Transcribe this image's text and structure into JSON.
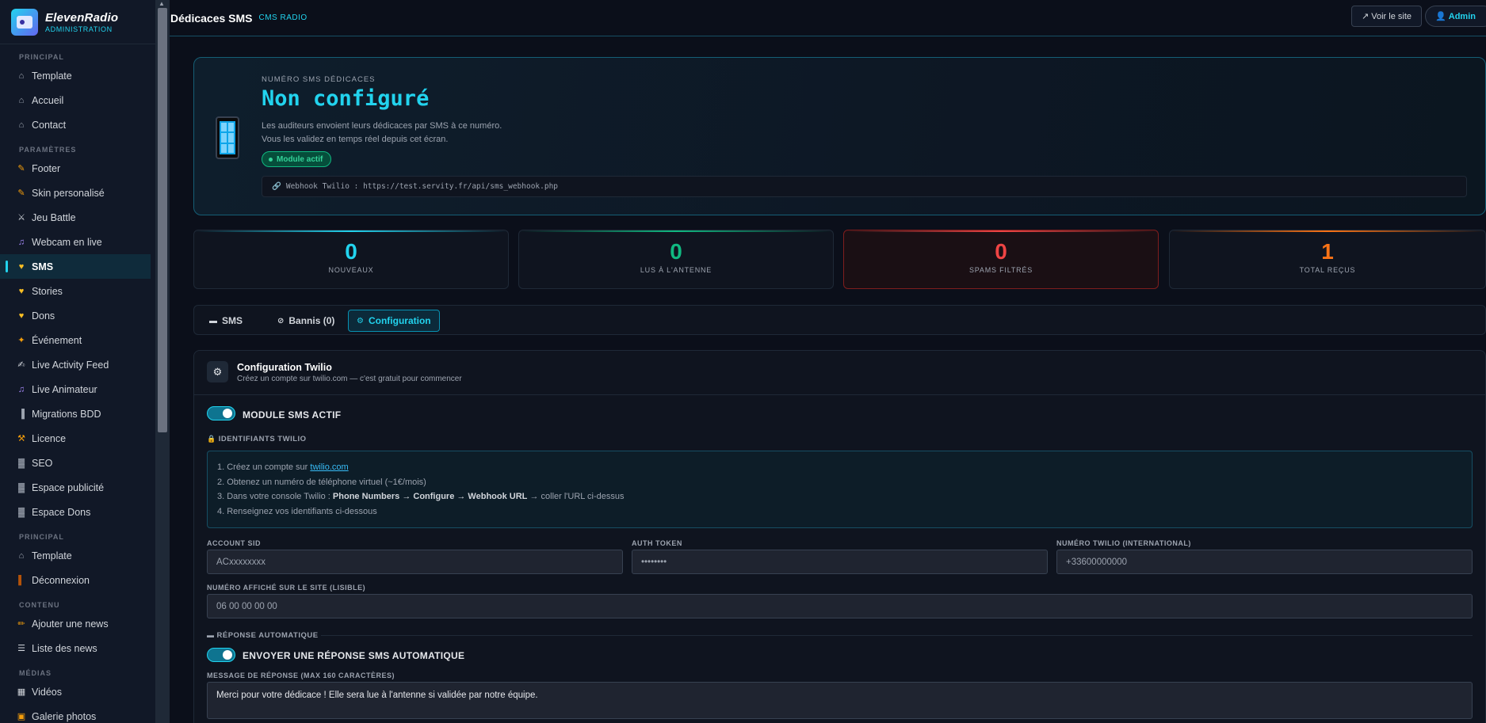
{
  "brand": {
    "name": "ElevenRadio",
    "subtitle": "ADMINISTRATION"
  },
  "sidebar": {
    "sections": [
      {
        "title": "PRINCIPAL",
        "items": [
          {
            "label": "Template",
            "icon": "home-icon",
            "glyph": "⌂"
          },
          {
            "label": "Accueil",
            "icon": "home-icon",
            "glyph": "⌂"
          },
          {
            "label": "Contact",
            "icon": "home-icon",
            "glyph": "⌂"
          }
        ]
      },
      {
        "title": "PARAMÈTRES",
        "items": [
          {
            "label": "Footer",
            "icon": "brush-icon",
            "glyph": "✎"
          },
          {
            "label": "Skin personalisé",
            "icon": "brush-icon",
            "glyph": "✎"
          },
          {
            "label": "Jeu Battle",
            "icon": "swords-icon",
            "glyph": "⚔"
          },
          {
            "label": "Webcam en live",
            "icon": "music-icon",
            "glyph": "♫"
          },
          {
            "label": "SMS",
            "icon": "heart-icon",
            "glyph": "♥",
            "active": true
          },
          {
            "label": "Stories",
            "icon": "heart-icon",
            "glyph": "♥"
          },
          {
            "label": "Dons",
            "icon": "heart-icon",
            "glyph": "♥"
          },
          {
            "label": "Événement",
            "icon": "party-icon",
            "glyph": "✦"
          },
          {
            "label": "Live Activity Feed",
            "icon": "feather-icon",
            "glyph": "✍"
          },
          {
            "label": "Live Animateur",
            "icon": "music-icon",
            "glyph": "♫"
          },
          {
            "label": "Migrations BDD",
            "icon": "database-icon",
            "glyph": "▐"
          },
          {
            "label": "Licence",
            "icon": "wrench-icon",
            "glyph": "⚒"
          },
          {
            "label": "SEO",
            "icon": "chart-icon",
            "glyph": "▓"
          },
          {
            "label": "Espace publicité",
            "icon": "chart-icon",
            "glyph": "▓"
          },
          {
            "label": "Espace Dons",
            "icon": "chart-icon",
            "glyph": "▓"
          }
        ]
      },
      {
        "title": "PRINCIPAL",
        "items": [
          {
            "label": "Template",
            "icon": "home-icon",
            "glyph": "⌂"
          },
          {
            "label": "Déconnexion",
            "icon": "door-icon",
            "glyph": "▌"
          }
        ]
      },
      {
        "title": "CONTENU",
        "items": [
          {
            "label": "Ajouter une news",
            "icon": "pencil-icon",
            "glyph": "✏"
          },
          {
            "label": "Liste des news",
            "icon": "list-icon",
            "glyph": "☰"
          }
        ]
      },
      {
        "title": "MÉDIAS",
        "items": [
          {
            "label": "Vidéos",
            "icon": "film-icon",
            "glyph": "▦"
          },
          {
            "label": "Galerie photos",
            "icon": "image-icon",
            "glyph": "▣"
          }
        ]
      }
    ]
  },
  "topbar": {
    "title": "Dédicaces SMS",
    "tag": "CMS RADIO",
    "view_site": "↗ Voir le site",
    "user": "👤 Admin"
  },
  "hero": {
    "label": "NUMÉRO SMS DÉDICACES",
    "number": "Non configuré",
    "desc_line1": "Les auditeurs envoient leurs dédicaces par SMS à ce numéro.",
    "desc_line2": "Vous les validez en temps réel depuis cet écran.",
    "status": "Module actif",
    "webhook": "Webhook Twilio : https://test.servity.fr/api/sms_webhook.php"
  },
  "stats": [
    {
      "value": "0",
      "label": "NOUVEAUX",
      "color": "#22d3ee"
    },
    {
      "value": "0",
      "label": "LUS À L'ANTENNE",
      "color": "#10b981"
    },
    {
      "value": "0",
      "label": "SPAMS FILTRÉS",
      "color": "#ef4444"
    },
    {
      "value": "1",
      "label": "TOTAL REÇUS",
      "color": "#f97316"
    }
  ],
  "tabs": [
    {
      "label": "SMS",
      "icon": "message-icon"
    },
    {
      "label": "Bannis (0)",
      "icon": "ban-icon"
    },
    {
      "label": "Configuration",
      "icon": "gear-icon",
      "active": true
    }
  ],
  "config": {
    "title": "Configuration Twilio",
    "subtitle": "Créez un compte sur twilio.com — c'est gratuit pour commencer",
    "module_toggle": "MODULE SMS ACTIF",
    "module_on": true,
    "credentials_title": "IDENTIFIANTS TWILIO",
    "steps": {
      "s1_prefix": "1. Créez un compte sur ",
      "s1_link": "twilio.com",
      "s2": "2. Obtenez un numéro de téléphone virtuel (~1€/mois)",
      "s3_prefix": "3. Dans votre console Twilio : ",
      "s3_bold": "Phone Numbers → Configure → Webhook URL",
      "s3_suffix": " → coller l'URL ci-dessus",
      "s4": "4. Renseignez vos identifiants ci-dessous"
    },
    "fields": {
      "account_sid_label": "ACCOUNT SID",
      "account_sid_placeholder": "ACxxxxxxxx",
      "auth_token_label": "AUTH TOKEN",
      "auth_token_placeholder": "••••••••",
      "twilio_number_label": "NUMÉRO TWILIO (INTERNATIONAL)",
      "twilio_number_placeholder": "+33600000000",
      "display_number_label": "NUMÉRO AFFICHÉ SUR LE SITE (LISIBLE)",
      "display_number_placeholder": "06 00 00 00 00"
    },
    "auto_reply_title": "RÉPONSE AUTOMATIQUE",
    "auto_reply_toggle": "ENVOYER UNE RÉPONSE SMS AUTOMATIQUE",
    "auto_reply_on": true,
    "reply_label": "MESSAGE DE RÉPONSE (MAX 160 CARACTÈRES)",
    "reply_value": "Merci pour votre dédicace ! Elle sera lue à l'antenne si validée par notre équipe."
  }
}
